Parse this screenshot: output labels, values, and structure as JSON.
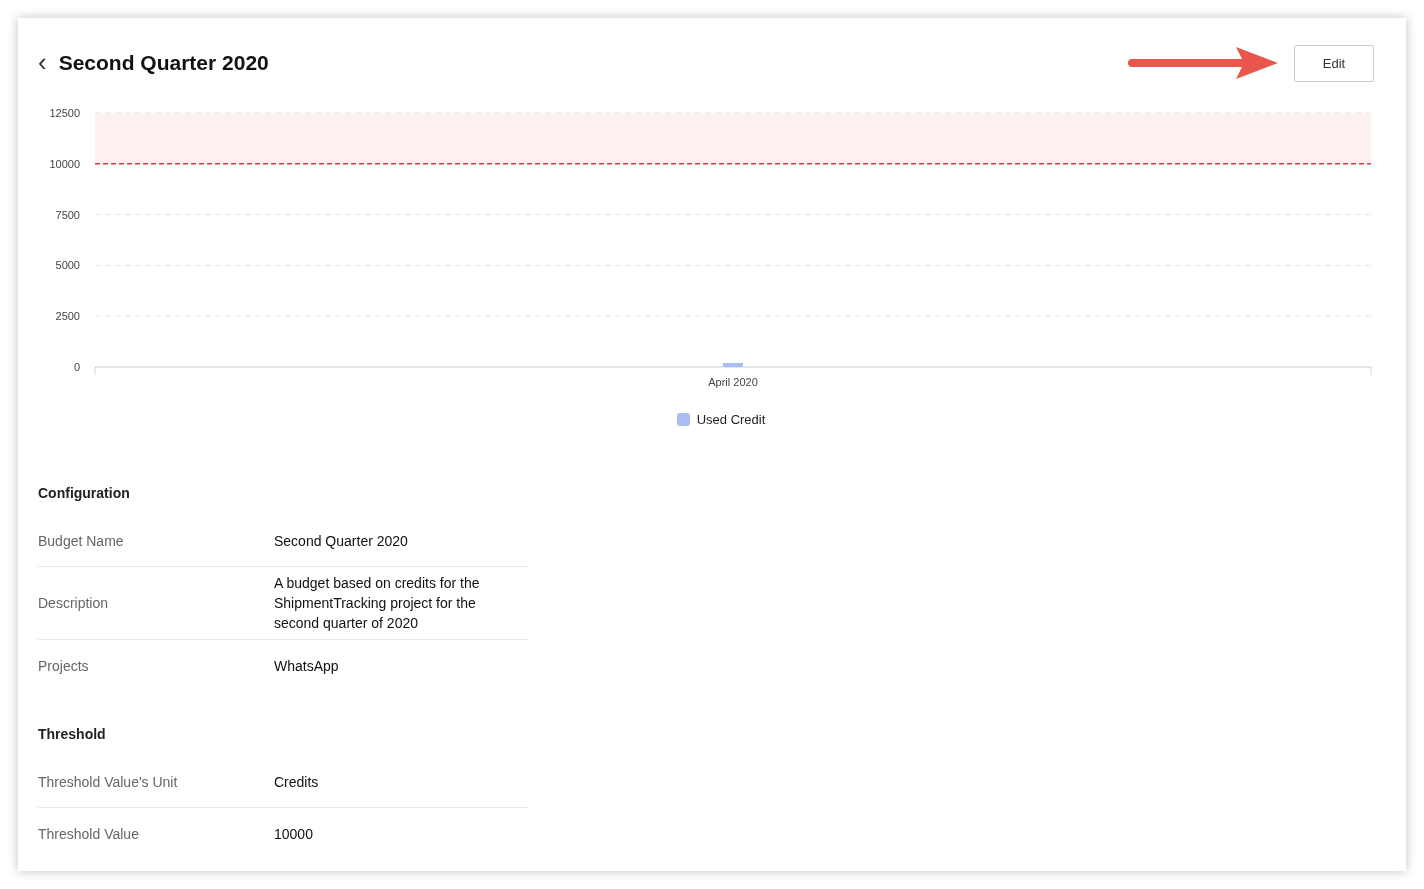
{
  "header": {
    "back_icon": "‹",
    "title": "Second Quarter 2020",
    "edit_button": "Edit"
  },
  "chart": {
    "chart_data": {
      "type": "bar",
      "categories": [
        "April 2020"
      ],
      "series": [
        {
          "name": "Used Credit",
          "color": "#a9bdf0",
          "values": [
            200
          ]
        }
      ],
      "ylim": [
        0,
        12500
      ],
      "yticks": [
        0,
        2500,
        5000,
        7500,
        10000,
        12500
      ],
      "grid": true,
      "ref_lines": [
        {
          "axis": "y",
          "value": 10000,
          "color": "#d93a3a"
        }
      ],
      "bands": [
        {
          "axis": "y",
          "from": 10000,
          "to": 12500,
          "color": "#fdf0f0"
        }
      ]
    }
  },
  "sections": [
    {
      "title": "Configuration",
      "rows": [
        {
          "label": "Budget Name",
          "value": "Second Quarter 2020"
        },
        {
          "label": "Description",
          "value": "A budget based on credits for the ShipmentTracking project for the second quarter of 2020"
        },
        {
          "label": "Projects",
          "value": "WhatsApp"
        }
      ]
    },
    {
      "title": "Threshold",
      "rows": [
        {
          "label": "Threshold Value's Unit",
          "value": "Credits"
        },
        {
          "label": "Threshold Value",
          "value": "10000"
        }
      ]
    }
  ]
}
